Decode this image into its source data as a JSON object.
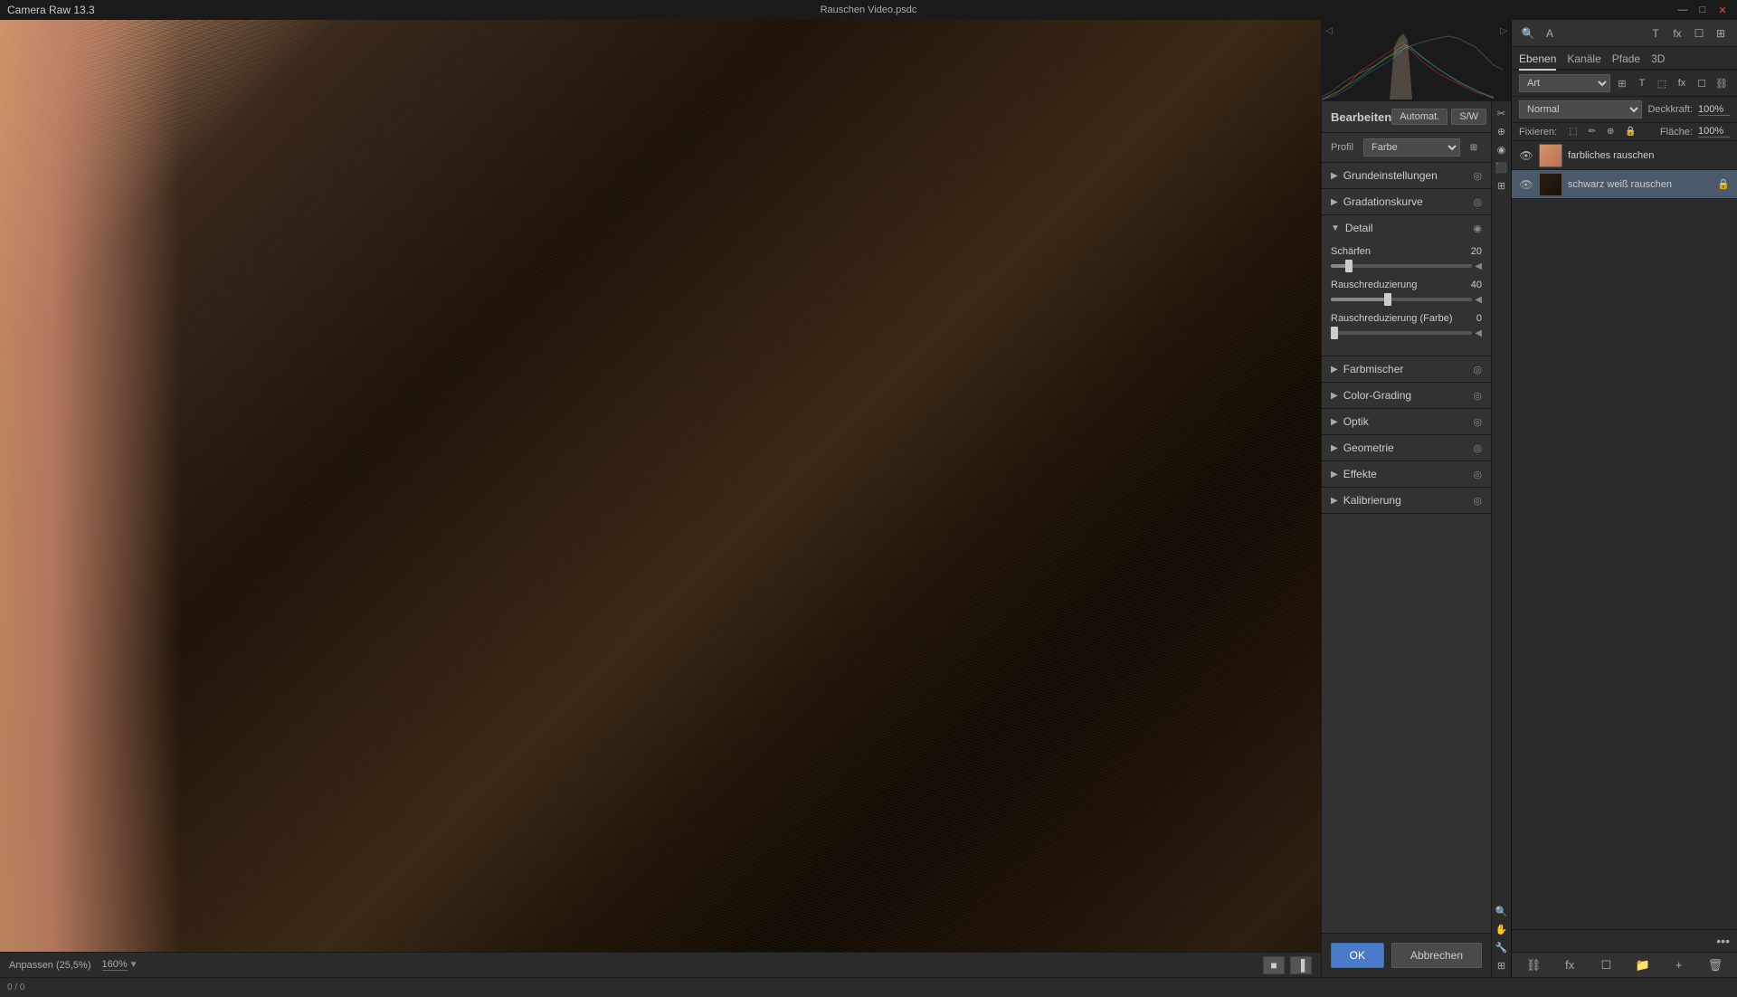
{
  "titleBar": {
    "appName": "Camera Raw 13.3",
    "fileName": "Rauschen Video.psdc",
    "controls": [
      "—",
      "□",
      "✕"
    ]
  },
  "canvasArea": {
    "zoomFit": "Anpassen (25,5%)",
    "zoomLevel": "160%"
  },
  "rawPanel": {
    "editTitle": "Bearbeiten",
    "autoButton": "Automat.",
    "bwButton": "S/W",
    "profileLabel": "Profil",
    "profileValue": "Farbe",
    "sections": [
      {
        "id": "grundeinstellungen",
        "label": "Grundeinstellungen",
        "expanded": false
      },
      {
        "id": "gradationskurve",
        "label": "Gradationskurve",
        "expanded": false
      },
      {
        "id": "detail",
        "label": "Detail",
        "expanded": true
      },
      {
        "id": "farbmischer",
        "label": "Farbmischer",
        "expanded": false
      },
      {
        "id": "color-grading",
        "label": "Color-Grading",
        "expanded": false
      },
      {
        "id": "optik",
        "label": "Optik",
        "expanded": false
      },
      {
        "id": "geometrie",
        "label": "Geometrie",
        "expanded": false
      },
      {
        "id": "effekte",
        "label": "Effekte",
        "expanded": false
      },
      {
        "id": "kalibrierung",
        "label": "Kalibrierung",
        "expanded": false
      }
    ],
    "detail": {
      "scharfen": {
        "label": "Schärfen",
        "value": 20,
        "max": 150,
        "fillPct": 13
      },
      "rauschreduzierung": {
        "label": "Rauschreduzierung",
        "value": 40,
        "max": 100,
        "fillPct": 40
      },
      "rauschreduzierungFarbe": {
        "label": "Rauschreduzierung (Farbe)",
        "value": 0,
        "max": 100,
        "fillPct": 0
      }
    }
  },
  "buttons": {
    "ok": "OK",
    "cancel": "Abbrechen"
  },
  "psPanel": {
    "tabs": [
      {
        "id": "ebenen",
        "label": "Ebenen",
        "active": true
      },
      {
        "id": "kanale",
        "label": "Kanäle"
      },
      {
        "id": "pfade",
        "label": "Pfade"
      },
      {
        "id": "3d",
        "label": "3D"
      }
    ],
    "artDropdown": "Art",
    "blendMode": "Normal",
    "opacityLabel": "Deckkraft:",
    "opacityValue": "100%",
    "lockLabel": "Fixieren:",
    "fillLabel": "Fläche:",
    "fillValue": "100%",
    "layers": [
      {
        "id": "layer1",
        "label": "farbliches rauschen",
        "type": "skin",
        "visible": true,
        "active": false
      },
      {
        "id": "layer2",
        "label": "schwarz weiß rauschen",
        "type": "dark",
        "visible": true,
        "active": true
      }
    ],
    "moreBtn": "•••"
  },
  "statusBar": {
    "coords": "0 / 0"
  }
}
